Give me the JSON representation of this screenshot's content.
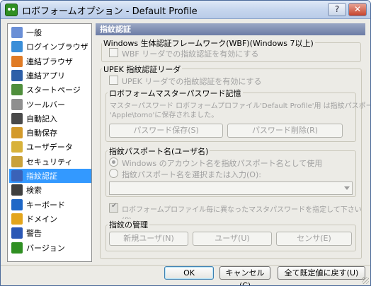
{
  "window": {
    "title": "ロボフォームオプション - Default Profile",
    "help_label": "?",
    "close_label": "✕"
  },
  "sidebar": {
    "items": [
      {
        "label": "一般",
        "icon": "settings-list-icon",
        "color": "#6a8fd6"
      },
      {
        "label": "ログインブラウザ",
        "icon": "globe-icon",
        "color": "#3a8ed8"
      },
      {
        "label": "連結ブラウザ",
        "icon": "globe-link-icon",
        "color": "#e07b25"
      },
      {
        "label": "連結アプリ",
        "icon": "app-window-icon",
        "color": "#2d5fa8"
      },
      {
        "label": "スタートページ",
        "icon": "home-icon",
        "color": "#4f8e3c"
      },
      {
        "label": "ツールバー",
        "icon": "toolbar-icon",
        "color": "#8f8f8f"
      },
      {
        "label": "自動記入",
        "icon": "keyboard-fill-icon",
        "color": "#4a4a4a"
      },
      {
        "label": "自動保存",
        "icon": "save-disk-icon",
        "color": "#d39a2b"
      },
      {
        "label": "ユーザデータ",
        "icon": "pencil-icon",
        "color": "#d8b23a"
      },
      {
        "label": "セキュリティ",
        "icon": "key-icon",
        "color": "#c9a13a"
      },
      {
        "label": "指紋認証",
        "icon": "fingerprint-icon",
        "color": "#3a62b8"
      },
      {
        "label": "検索",
        "icon": "magnifier-icon",
        "color": "#3f3f3f"
      },
      {
        "label": "キーボード",
        "icon": "mouse-keyboard-icon",
        "color": "#1e67c7"
      },
      {
        "label": "ドメイン",
        "icon": "dotcom-icon",
        "color": "#e3a51c"
      },
      {
        "label": "警告",
        "icon": "checkbox-warning-icon",
        "color": "#2a57b5"
      },
      {
        "label": "バージョン",
        "icon": "robot-icon",
        "color": "#2f8f22"
      }
    ],
    "selected_index": 10
  },
  "panel": {
    "header": "指紋認証",
    "wbf_group_title": "Windows 生体認証フレームワーク(WBF)(Windows 7以上)",
    "wbf_checkbox_label": "WBF リーダでの指紋認証を有効にする",
    "upek_group_title": "UPEK 指紋認証リーダ",
    "upek_checkbox_label": "UPEK リーダでの指紋認証を有効にする",
    "master_group_title": "ロボフォームマスターパスワード記憶",
    "master_text_line1": "マスターパスワード ロボフォームプロファイル'Default Profile'用 は指紋パスポート",
    "master_text_line2": "'Apple\\tomo'に保存されました。",
    "save_password_button": "パスワード保存(S)",
    "delete_password_button": "パスワード削除(R)",
    "passport_group_title": "指紋パスポート名(ユーザ名)",
    "radio_windows_label": "Windows のアカウント名を指紋パスポート名として使用",
    "radio_select_label": "指紋パスポート名を選択または入力(O):",
    "combo_value": "",
    "profile_checkbox_label": "ロボフォームプロファイル毎に異なったマスタパスワードを指定して下さい(P)。",
    "manage_group_title": "指紋の管理",
    "new_user_button": "新規ユーザ(N)",
    "user_button": "ユーザ(U)",
    "sensor_button": "センサ(E)"
  },
  "footer": {
    "ok_button": "OK",
    "cancel_button": "キャンセル(C)",
    "reset_button": "全て既定値に戻す(U)"
  }
}
